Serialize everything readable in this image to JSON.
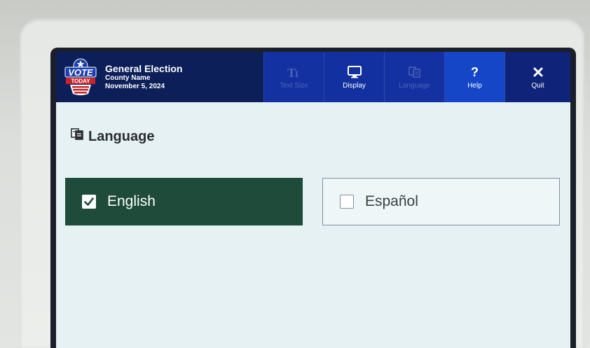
{
  "header": {
    "logo": {
      "top": "VOTE",
      "bottom": "TODAY"
    },
    "election_title": "General Election",
    "county": "County Name",
    "date": "November 5, 2024"
  },
  "toolbar": [
    {
      "label": "Text Size",
      "icon": "text-size-icon",
      "enabled": false
    },
    {
      "label": "Display",
      "icon": "monitor-icon",
      "enabled": true
    },
    {
      "label": "Language",
      "icon": "language-icon",
      "enabled": false
    },
    {
      "label": "Help",
      "icon": "question-icon",
      "enabled": true
    },
    {
      "label": "Quit",
      "icon": "close-icon",
      "enabled": true
    }
  ],
  "page": {
    "title": "Language"
  },
  "options": [
    {
      "label": "English",
      "selected": true
    },
    {
      "label": "Español",
      "selected": false
    }
  ],
  "colors": {
    "header_bg": "#0d1f59",
    "toolbar_bg": "#1330a0",
    "selected_bg": "#1e4b3a",
    "screen_bg": "#e6f1f3"
  }
}
